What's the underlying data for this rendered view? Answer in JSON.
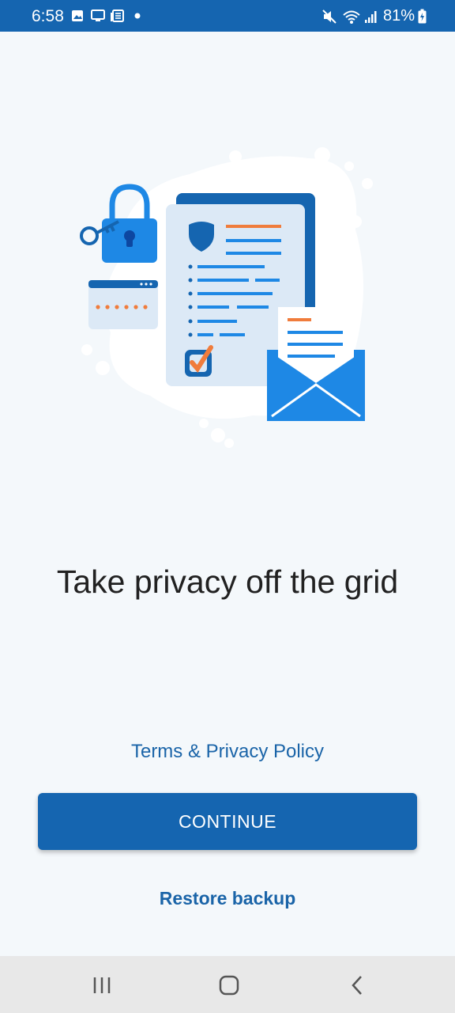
{
  "status_bar": {
    "time": "6:58",
    "battery": "81%",
    "icons": [
      "image-icon",
      "monitor-icon",
      "news-icon",
      "dot-icon",
      "mute-icon",
      "wifi-icon",
      "signal-icon",
      "battery-icon"
    ]
  },
  "onboarding": {
    "headline": "Take privacy off the grid",
    "terms_link": "Terms & Privacy Policy",
    "continue_label": "CONTINUE",
    "restore_label": "Restore backup"
  },
  "nav_bar": {
    "icons": [
      "recents-icon",
      "home-icon",
      "back-icon"
    ]
  },
  "colors": {
    "accent": "#1565b0",
    "link": "#1a64a8",
    "background": "#f4f8fb",
    "illustration_orange": "#f07c3c",
    "illustration_blue": "#1e88e5"
  }
}
